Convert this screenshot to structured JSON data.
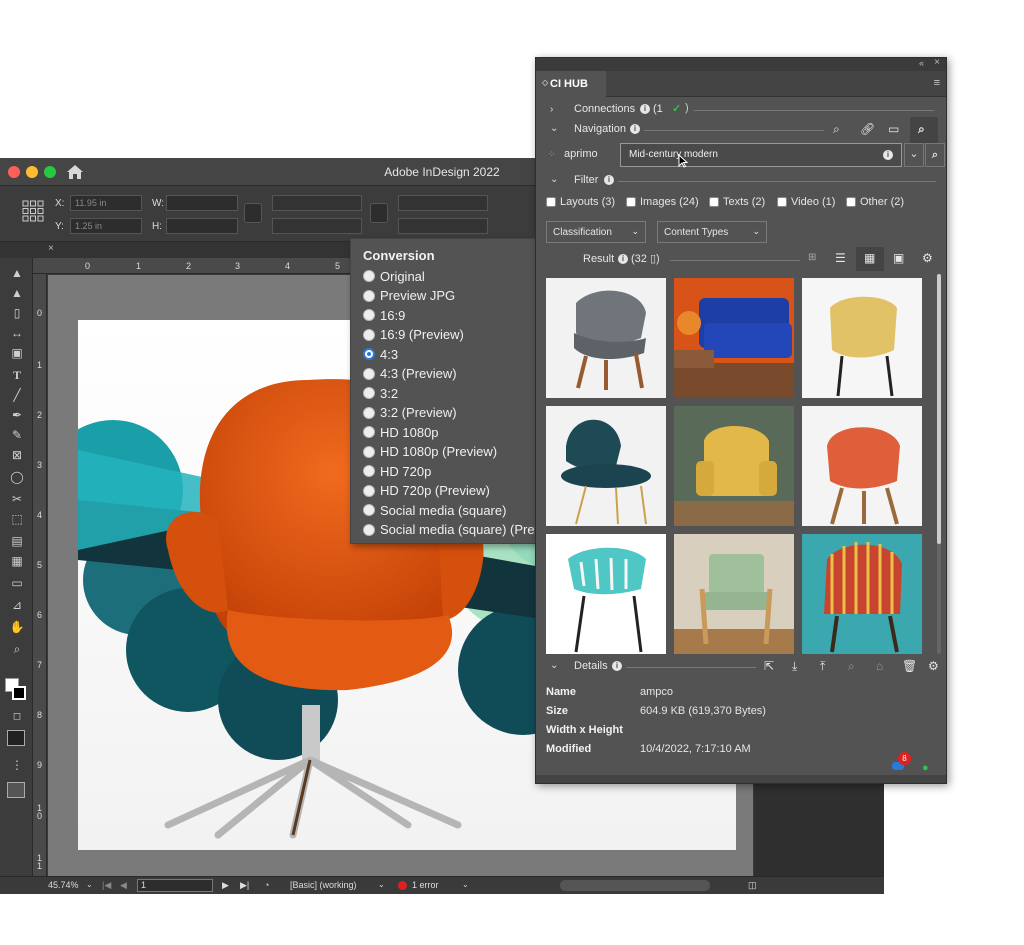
{
  "indesign": {
    "title": "Adobe InDesign 2022",
    "control": {
      "x_label": "X:",
      "x_value": "11.95 in",
      "y_label": "Y:",
      "y_value": "1.25 in",
      "w_label": "W:",
      "h_label": "H:"
    },
    "ruler_top": [
      "0",
      "1",
      "2",
      "3",
      "4",
      "5"
    ],
    "ruler_left": [
      "0",
      "1",
      "2",
      "3",
      "4",
      "5",
      "6",
      "7",
      "8",
      "9",
      "1\n0",
      "1\n1"
    ],
    "status": {
      "zoom": "45.74%",
      "page": "1",
      "preflight_profile": "[Basic] (working)",
      "errors": "1 error"
    }
  },
  "conversion": {
    "title": "Conversion",
    "options": [
      {
        "label": "Original",
        "selected": false
      },
      {
        "label": "Preview JPG",
        "selected": false
      },
      {
        "label": "16:9",
        "selected": false
      },
      {
        "label": "16:9 (Preview)",
        "selected": false
      },
      {
        "label": "4:3",
        "selected": true
      },
      {
        "label": "4:3 (Preview)",
        "selected": false
      },
      {
        "label": "3:2",
        "selected": false
      },
      {
        "label": "3:2 (Preview)",
        "selected": false
      },
      {
        "label": "HD 1080p",
        "selected": false
      },
      {
        "label": "HD 1080p (Preview)",
        "selected": false
      },
      {
        "label": "HD 720p",
        "selected": false
      },
      {
        "label": "HD 720p (Preview)",
        "selected": false
      },
      {
        "label": "Social media (square)",
        "selected": false
      },
      {
        "label": "Social media (square) (Preview)",
        "selected": false
      }
    ]
  },
  "cihub": {
    "tab": "CI HUB",
    "connections_label": "Connections",
    "connections_count": "(1",
    "navigation_label": "Navigation",
    "source": "aprimo",
    "search_value": "Mid-century modern",
    "filter_label": "Filter",
    "filters": [
      "Layouts (3)",
      "Images (24)",
      "Texts (2)",
      "Video (1)",
      "Other (2)"
    ],
    "classification": "Classification",
    "content_types": "Content Types",
    "result_label": "Result",
    "result_count": "(32",
    "details_label": "Details",
    "details": [
      {
        "key": "Name",
        "value": "ampco"
      },
      {
        "key": "Size",
        "value": "604.9 KB (619,370 Bytes)"
      },
      {
        "key": "Width x Height",
        "value": ""
      },
      {
        "key": "Modified",
        "value": "10/4/2022, 7:17:10 AM"
      }
    ],
    "notification_count": "8",
    "colors": {
      "accent": "#2a7bd4",
      "success": "#2ec44a",
      "badge": "#e02020"
    }
  }
}
